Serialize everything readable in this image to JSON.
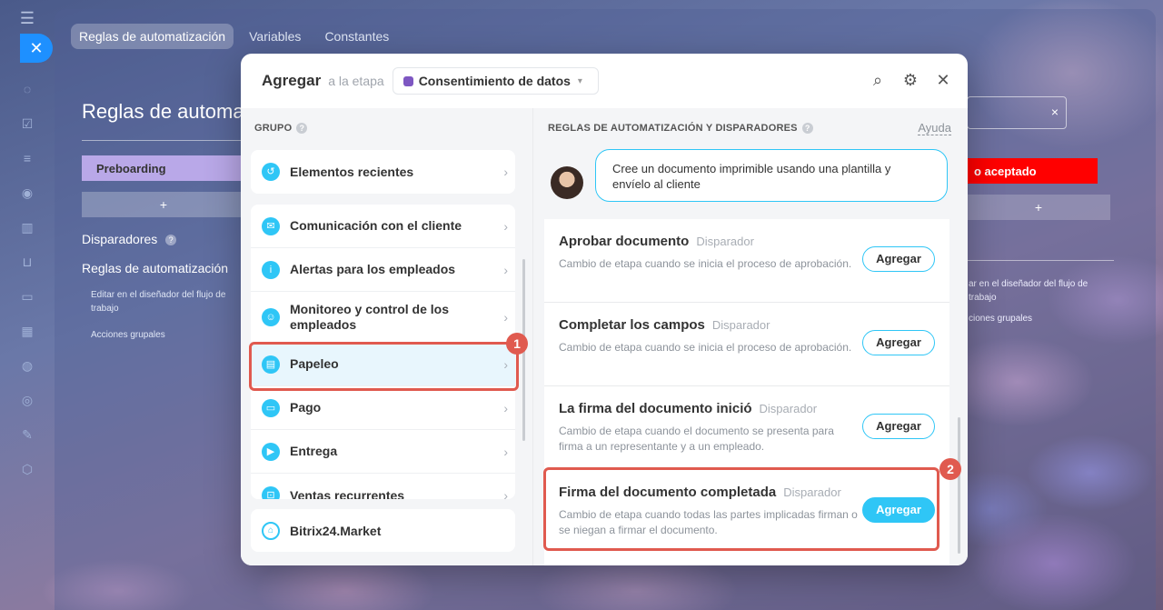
{
  "top_tabs": [
    "Reglas de automatización",
    "Variables",
    "Constantes"
  ],
  "background": {
    "title": "Reglas de automa",
    "stage": "Preboarding",
    "plus": "+",
    "triggers": "Disparadores",
    "rules": "Reglas de automatización",
    "sub1": "Editar en el diseñador del flujo de trabajo",
    "sub2": "Acciones grupales",
    "right_input_x": "×",
    "right_red": "o aceptado",
    "right_sub1": "ar en el diseñador del flujo de trabajo",
    "right_sub2": "ciones grupales"
  },
  "dialog": {
    "title": "Agregar",
    "subtitle": "a la etapa",
    "stage": "Consentimiento de datos",
    "group_header": "GRUPO",
    "groups_top": [
      {
        "label": "Elementos recientes",
        "icon": "history-icon"
      }
    ],
    "groups": [
      {
        "label": "Comunicación con el cliente",
        "icon": "chat-icon"
      },
      {
        "label": "Alertas para los empleados",
        "icon": "info-icon"
      },
      {
        "label": "Monitoreo y control de los empleados",
        "icon": "people-icon"
      },
      {
        "label": "Papeleo",
        "icon": "document-icon"
      },
      {
        "label": "Pago",
        "icon": "wallet-icon"
      },
      {
        "label": "Entrega",
        "icon": "truck-icon"
      },
      {
        "label": "Ventas recurrentes",
        "icon": "cart-icon"
      }
    ],
    "market": "Bitrix24.Market",
    "rules_header": "REGLAS DE AUTOMATIZACIÓN Y DISPARADORES",
    "help": "Ayuda",
    "bubble": "Cree un documento imprimible usando una plantilla y envíelo al cliente",
    "rules": [
      {
        "title": "Aprobar documento",
        "tag": "Disparador",
        "desc": "Cambio de etapa cuando se inicia el proceso de aprobación.",
        "button": "Agregar"
      },
      {
        "title": "Completar los campos",
        "tag": "Disparador",
        "desc": "Cambio de etapa cuando se inicia el proceso de aprobación.",
        "button": "Agregar"
      },
      {
        "title": "La firma del documento inició",
        "tag": "Disparador",
        "desc": "Cambio de etapa cuando el documento se presenta para firma a un representante y a un empleado.",
        "button": "Agregar"
      },
      {
        "title": "Firma del documento completada",
        "tag": "Disparador",
        "desc": "Cambio de etapa cuando todas las partes implicadas firman o se niegan a firmar el documento.",
        "button": "Agregar"
      }
    ]
  },
  "callouts": [
    "1",
    "2"
  ],
  "colors": {
    "accent": "#2fc6f6",
    "highlight": "#e05a4f",
    "stage": "#7e57c2"
  }
}
